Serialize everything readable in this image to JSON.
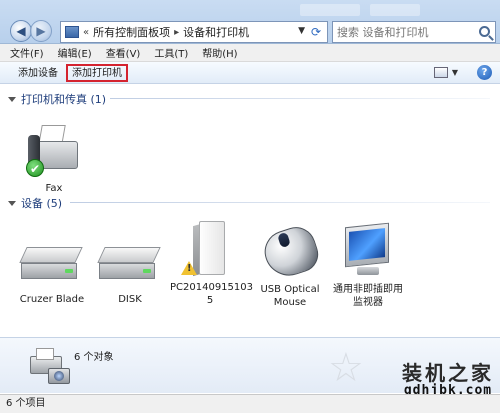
{
  "nav": {
    "back_icon": "back-arrow-icon",
    "forward_icon": "forward-arrow-icon",
    "breadcrumb": [
      "«",
      "所有控制面板项",
      "▸",
      "设备和打印机"
    ],
    "search_placeholder": "搜索 设备和打印机"
  },
  "menu": {
    "items": [
      "文件(F)",
      "编辑(E)",
      "查看(V)",
      "工具(T)",
      "帮助(H)"
    ]
  },
  "toolbar": {
    "add_device": "添加设备",
    "add_printer": "添加打印机",
    "highlight_color": "#d4232f"
  },
  "groups": {
    "printers": {
      "header": "打印机和传真 (1)",
      "items": [
        {
          "label": "Fax",
          "icon": "fax-printer-icon",
          "default": true
        }
      ]
    },
    "devices": {
      "header": "设备 (5)",
      "items": [
        {
          "label": "Cruzer Blade",
          "icon": "disk-drive-icon"
        },
        {
          "label": "DISK",
          "icon": "disk-drive-icon"
        },
        {
          "label": "PC20140915103 5",
          "line1": "PC20140915103",
          "line2": "5",
          "icon": "pc-tower-icon",
          "warning": true
        },
        {
          "label": "USB Optical Mouse",
          "line1": "USB Optical",
          "line2": "Mouse",
          "icon": "mouse-icon"
        },
        {
          "label": "通用非即插即用监视器",
          "line1": "通用非即插即用",
          "line2": "监视器",
          "icon": "monitor-icon"
        }
      ]
    }
  },
  "details": {
    "count_text": "6 个对象",
    "icon": "devices-printers-icon"
  },
  "status": {
    "text": "6 个项目"
  },
  "watermark": {
    "title": "装机之家",
    "url": "gdhjbk.com"
  },
  "colors": {
    "group_header": "#1e3d7b",
    "chrome": "#c9dcf2"
  }
}
